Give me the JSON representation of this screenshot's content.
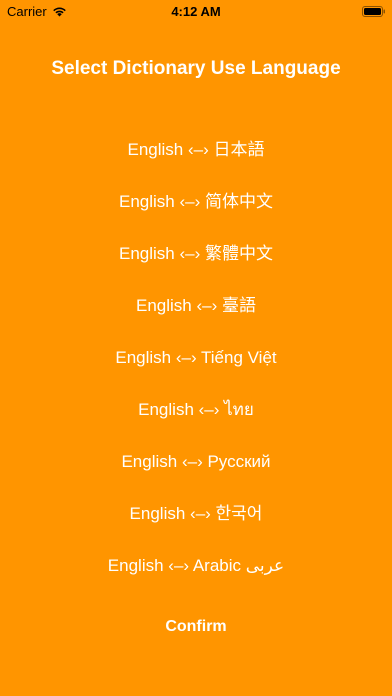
{
  "status_bar": {
    "carrier": "Carrier",
    "time": "4:12 AM"
  },
  "page": {
    "title": "Select Dictionary Use Language"
  },
  "languages": [
    {
      "label": "English ‹–› 日本語"
    },
    {
      "label": "English ‹–› 简体中文"
    },
    {
      "label": "English ‹–› 繁體中文"
    },
    {
      "label": "English ‹–› 臺語"
    },
    {
      "label": "English ‹–› Tiếng Việt"
    },
    {
      "label": "English ‹–› ไทย"
    },
    {
      "label": "English ‹–› Русский"
    },
    {
      "label": "English ‹–› 한국어"
    },
    {
      "label": "English ‹–› Arabic عربى"
    }
  ],
  "confirm_label": "Confirm",
  "colors": {
    "background": "#FF9500",
    "text": "#FFFFFF"
  }
}
